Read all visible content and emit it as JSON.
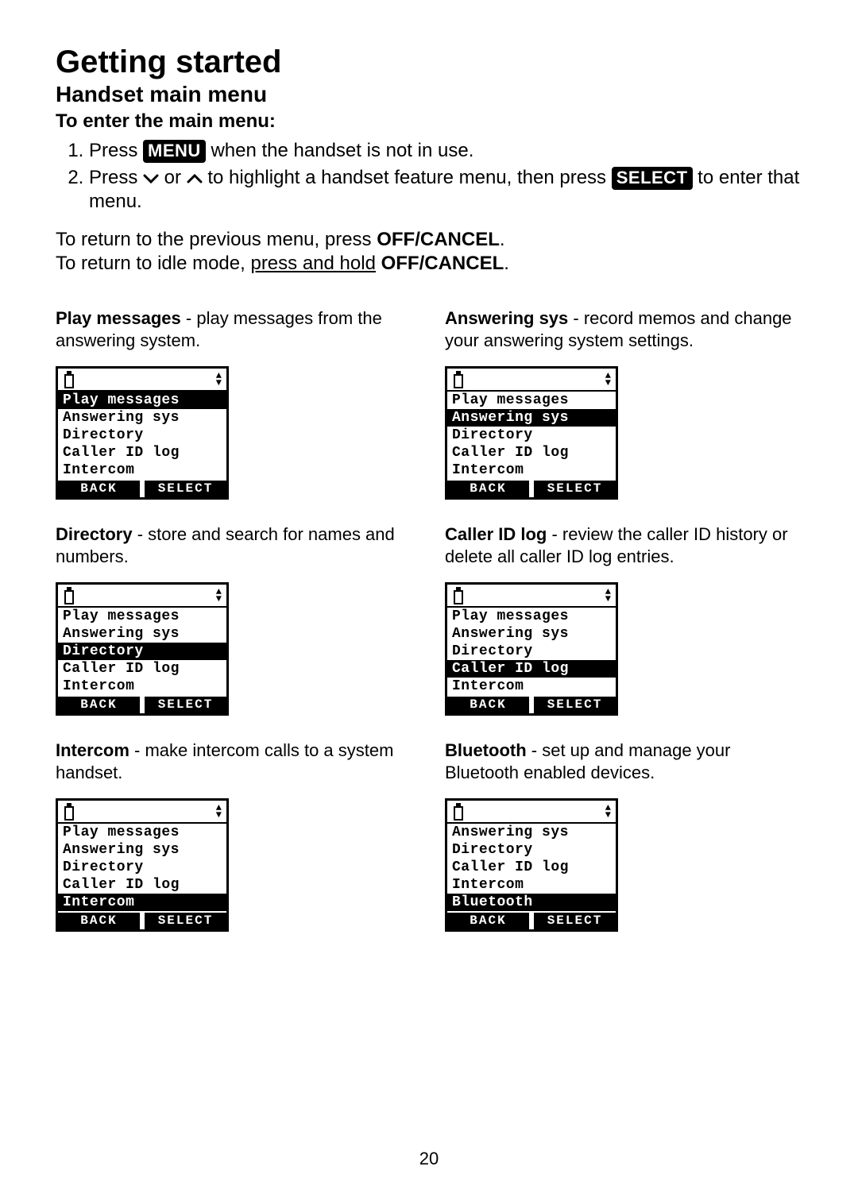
{
  "page_number": "20",
  "title": "Getting started",
  "subtitle": "Handset main menu",
  "instruction_heading": "To enter the main menu:",
  "steps": {
    "s1_a": "Press ",
    "s1_btn": "MENU",
    "s1_b": " when the handset is not in use.",
    "s2_a": "Press ",
    "s2_b": " or ",
    "s2_c": " to highlight a handset feature menu, then press ",
    "s2_btn": "SELECT",
    "s2_d": " to enter that menu."
  },
  "return_prev_a": "To return to the previous menu, press ",
  "return_prev_b": "OFF/CANCEL",
  "return_prev_c": ".",
  "return_idle_a": "To return to idle mode, ",
  "return_idle_u": "press and hold",
  "return_idle_b": " ",
  "return_idle_c": "OFF/CANCEL",
  "return_idle_d": ".",
  "menu_items_full": [
    "Play messages",
    "Answering sys",
    "Directory",
    "Caller ID log",
    "Intercom"
  ],
  "menu_items_shifted": [
    "Answering sys",
    "Directory",
    "Caller ID log",
    "Intercom",
    "Bluetooth"
  ],
  "softkeys": {
    "left": "BACK",
    "right": "SELECT"
  },
  "cells": [
    {
      "title": "Play messages",
      "desc": " - play messages from the answering system.",
      "list": "full",
      "selected_index": 0
    },
    {
      "title": "Answering sys",
      "desc": " - record memos and change your answering system settings.",
      "list": "full",
      "selected_index": 1
    },
    {
      "title": "Directory",
      "desc": " - store and search for names and numbers.",
      "list": "full",
      "selected_index": 2
    },
    {
      "title": "Caller ID log",
      "desc": " - review the caller ID history or delete all caller ID log entries.",
      "list": "full",
      "selected_index": 3
    },
    {
      "title": "Intercom",
      "desc": " - make intercom calls to a system handset.",
      "list": "full",
      "selected_index": 4
    },
    {
      "title": "Bluetooth",
      "desc": " - set up and manage your Bluetooth enabled devices.",
      "list": "shifted",
      "selected_index": 4
    }
  ]
}
